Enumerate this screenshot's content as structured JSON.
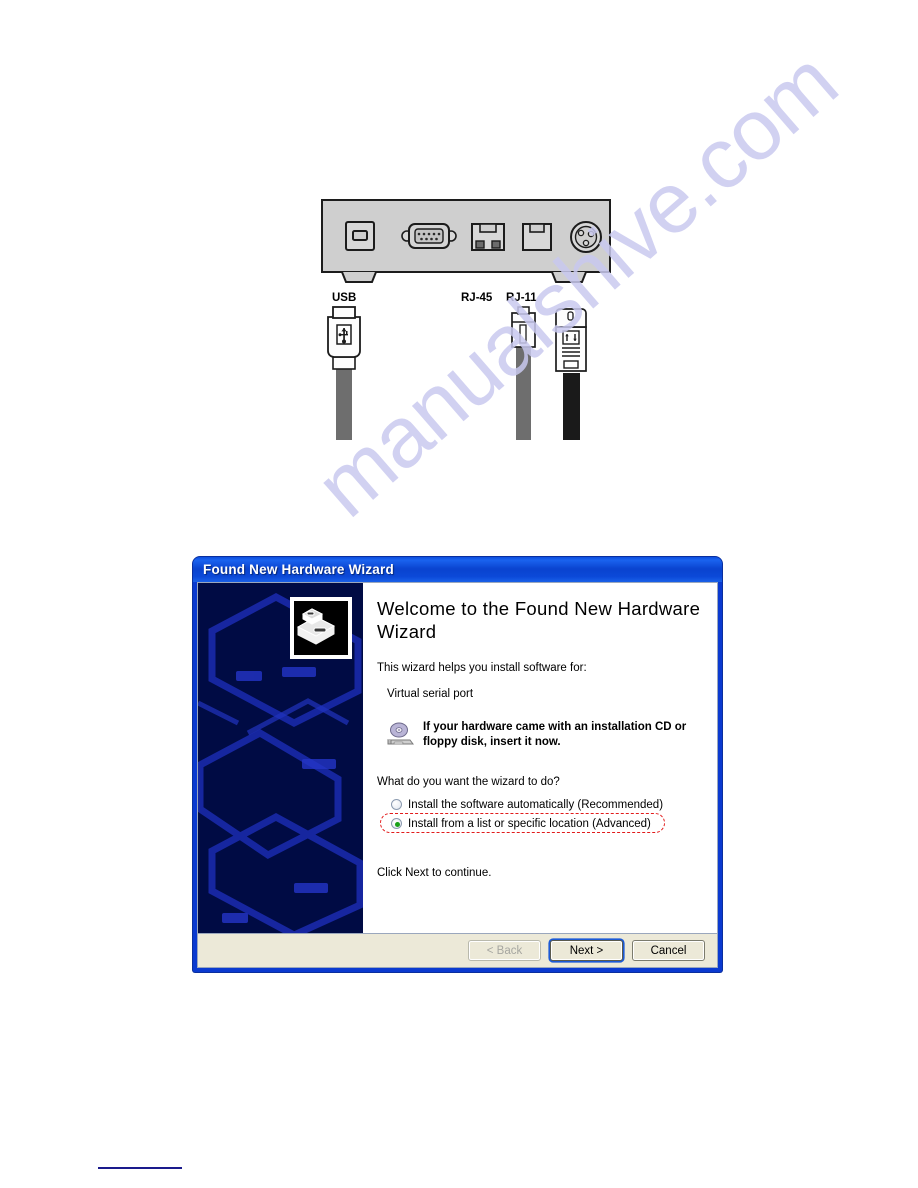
{
  "watermark": {
    "text": "manualshive.com"
  },
  "figure": {
    "panel_name": "device-rear-panel",
    "ports": [
      {
        "name": "usb-b-port",
        "label": "USB"
      },
      {
        "name": "db9-serial-port",
        "label": ""
      },
      {
        "name": "rj45-port",
        "label": "RJ-45"
      },
      {
        "name": "rj11-port",
        "label": "RJ-11"
      },
      {
        "name": "din-power-port",
        "label": ""
      }
    ],
    "cable_labels": {
      "usb": "USB",
      "rj45": "RJ-45",
      "rj11": "RJ-11"
    },
    "cables": [
      {
        "name": "usb-b-cable"
      },
      {
        "name": "rj11-cable"
      },
      {
        "name": "usb-cable"
      }
    ],
    "colors": {
      "panel_fill": "#cfcfcf",
      "cable_grey": "#6e6e6e",
      "cable_black": "#1a1a1a"
    }
  },
  "dialog": {
    "title": "Found New Hardware Wizard",
    "heading": "Welcome to the Found New Hardware Wizard",
    "intro": "This wizard helps you install software for:",
    "device": "Virtual serial port",
    "cd_notice": "If your hardware came with an installation CD or floppy disk, insert it now.",
    "question": "What do you want the wizard to do?",
    "options": [
      {
        "label": "Install the software automatically (Recommended)",
        "selected": false
      },
      {
        "label": "Install from a list or specific location (Advanced)",
        "selected": true
      }
    ],
    "footer_note": "Click Next to continue.",
    "buttons": {
      "back": "< Back",
      "next": "Next >",
      "cancel": "Cancel"
    },
    "colors": {
      "titlebar": "#0b49d8",
      "banner": "#000b44",
      "footer": "#ece9d8",
      "highlight": "#e21b1b",
      "radio_dot": "#18a018"
    }
  }
}
